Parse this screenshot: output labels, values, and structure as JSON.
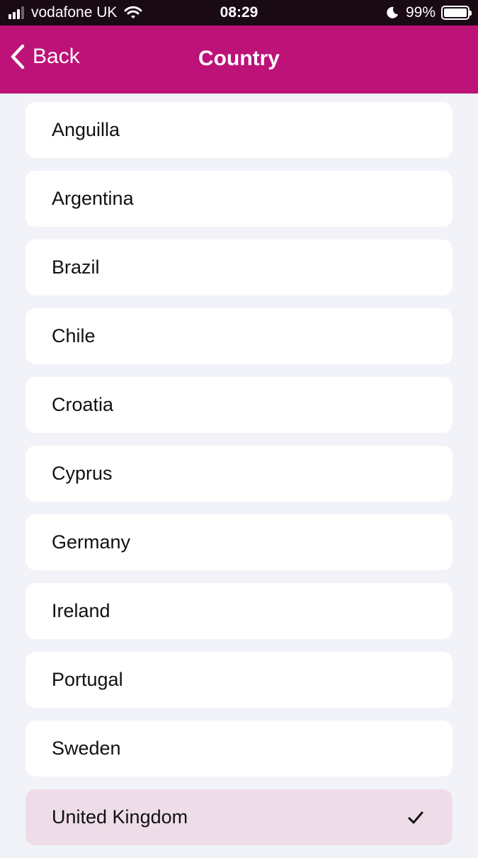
{
  "status_bar": {
    "carrier": "vodafone UK",
    "time": "08:29",
    "battery_percent": "99%",
    "battery_level": 0.99,
    "signal_bars": 3,
    "signal_bars_total": 4,
    "icons": [
      "signal-icon",
      "wifi-icon",
      "moon-icon",
      "battery-icon"
    ]
  },
  "nav": {
    "back_label": "Back",
    "title": "Country",
    "background_color": "#bd1278"
  },
  "countries": [
    {
      "name": "Anguilla",
      "selected": false
    },
    {
      "name": "Argentina",
      "selected": false
    },
    {
      "name": "Brazil",
      "selected": false
    },
    {
      "name": "Chile",
      "selected": false
    },
    {
      "name": "Croatia",
      "selected": false
    },
    {
      "name": "Cyprus",
      "selected": false
    },
    {
      "name": "Germany",
      "selected": false
    },
    {
      "name": "Ireland",
      "selected": false
    },
    {
      "name": "Portugal",
      "selected": false
    },
    {
      "name": "Sweden",
      "selected": false
    },
    {
      "name": "United Kingdom",
      "selected": true
    }
  ],
  "colors": {
    "selected_row": "#eedde9",
    "list_background": "#f2f3f8"
  }
}
